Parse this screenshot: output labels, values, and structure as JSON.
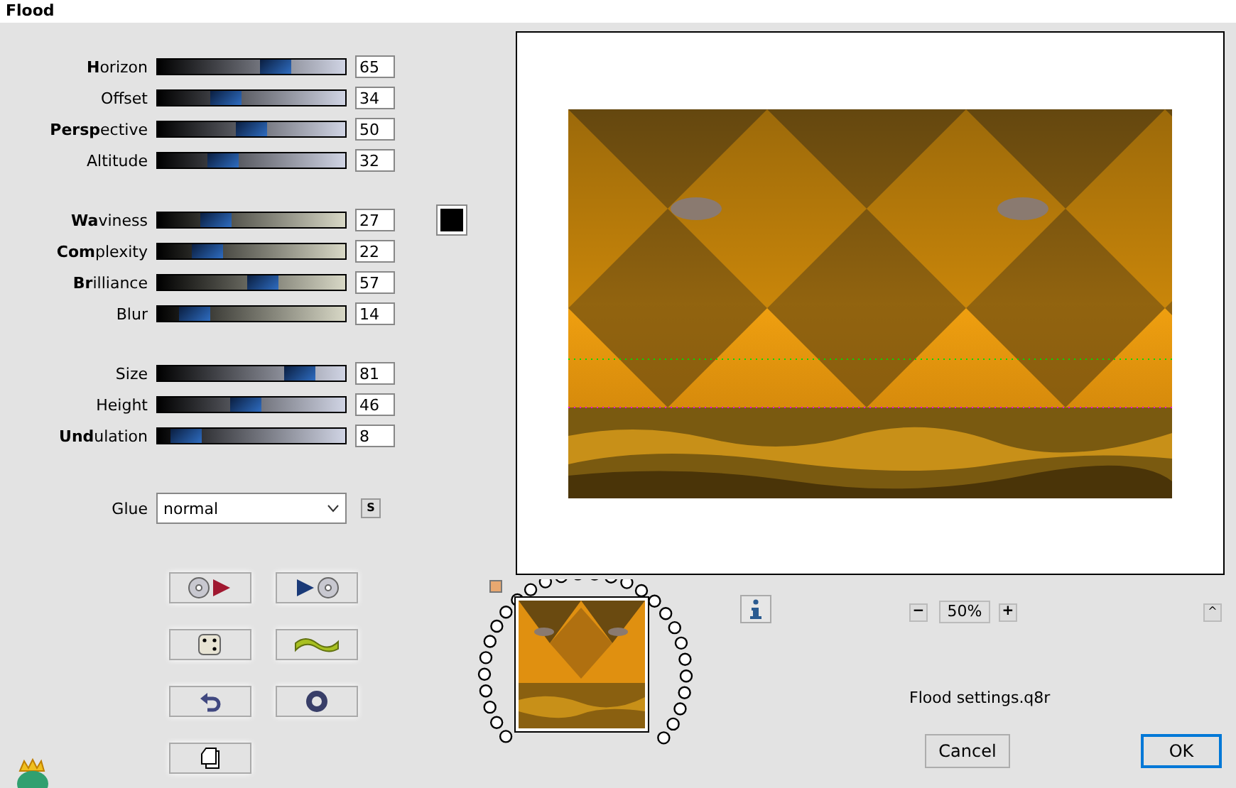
{
  "window": {
    "title": "Flood"
  },
  "slider_groups": [
    [
      {
        "label": "**H**orizon",
        "level": 0.65,
        "value": "65"
      },
      {
        "label": "Offset",
        "level": 0.34,
        "value": "34"
      },
      {
        "label": "**Persp**ective",
        "level": 0.5,
        "value": "50"
      },
      {
        "label": "Altitude",
        "level": 0.32,
        "value": "32"
      }
    ],
    [
      {
        "label": "**Wa**viness",
        "level": 0.27,
        "value": "27"
      },
      {
        "label": "**Com**plexity",
        "level": 0.22,
        "value": "22"
      },
      {
        "label": "**Br**illiance",
        "level": 0.57,
        "value": "57"
      },
      {
        "label": "Blur",
        "level": 0.14,
        "value": "14"
      }
    ],
    [
      {
        "label": "Size",
        "level": 0.81,
        "value": "81"
      },
      {
        "label": "Height",
        "level": 0.46,
        "value": "46"
      },
      {
        "label": "**Und**ulation",
        "level": 0.08,
        "value": "8"
      }
    ]
  ],
  "wave_color": {
    "color": "#000000"
  },
  "glue": {
    "label": "Glue",
    "value": "normal",
    "side_button": "S"
  },
  "zoom": {
    "minus": "−",
    "value": "50%",
    "plus": "+"
  },
  "collapse": "^",
  "status": "Flood settings.q8r",
  "buttons": [
    {
      "label": "Cancel",
      "default": false
    },
    {
      "label": "OK",
      "default": true
    }
  ]
}
